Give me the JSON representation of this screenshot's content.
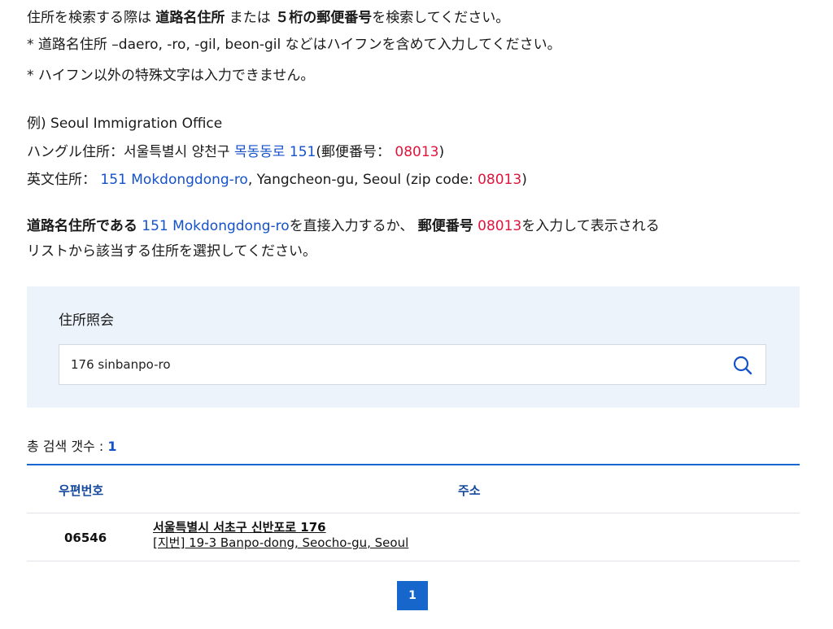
{
  "intro": {
    "line1": {
      "a": "住所を検索する際は ",
      "b": "道路名住所",
      "c": " または ",
      "d": "５桁の郵便番号",
      "e": "を検索してください。"
    },
    "line2": "* 道路名住所 –daero, -ro, -gil, beon-gil などはハイフンを含めて入力してください。",
    "line3": "* ハイフン以外の特殊文字は入力できません。"
  },
  "example": {
    "heading": "例) Seoul Immigration Office",
    "korean": {
      "prefix": "ハングル住所：서울특별시 양천구 ",
      "road": "목동동로 151",
      "zip_prefix": "(郵便番号： ",
      "zip": "08013",
      "suffix": ")"
    },
    "english": {
      "prefix": "英文住所： ",
      "road": "151 Mokdongdong-ro",
      "middle": ", Yangcheon-gu, Seoul (zip code: ",
      "zip": "08013",
      "suffix": ")"
    }
  },
  "instruction": {
    "a": "道路名住所である",
    "b": " 151 Mokdongdong-ro",
    "c": "を直接入力するか、 ",
    "d": "郵便番号",
    "e": " 08013",
    "f": "を入力して表示される",
    "line2": "リストから該当する住所を選択してください。"
  },
  "search": {
    "label": "住所照会",
    "value": "176 sinbanpo-ro",
    "icon": "search-icon"
  },
  "results": {
    "total_label": "총 검색 갯수 : ",
    "total_count": "1",
    "columns": [
      "우편번호",
      "주소"
    ],
    "rows": [
      {
        "zip": "06546",
        "road_address": "서울특별시 서초구 신반포로 176",
        "jibun_address": "[지번] 19-3 Banpo-dong, Seocho-gu, Seoul"
      }
    ]
  },
  "pagination": {
    "current": "1"
  },
  "colors": {
    "link_blue": "#1552c9",
    "zip_red": "#e0143c",
    "panel_bg": "#edf3fb",
    "accent": "#1666cc",
    "header_text": "#14489c"
  }
}
